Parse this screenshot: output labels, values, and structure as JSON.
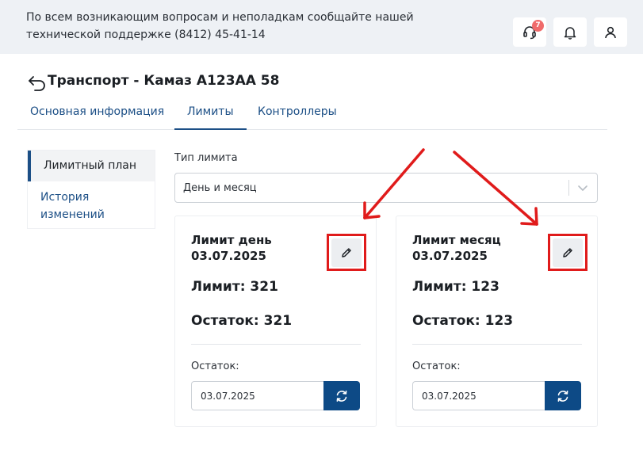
{
  "header": {
    "support_text": "По всем возникающим вопросам и неполадкам сообщайте нашей технической поддержке (8412) 45-41-14",
    "support_badge_count": "7",
    "icons": [
      "headset-icon",
      "bell-icon",
      "user-icon"
    ]
  },
  "page": {
    "title": "Транспорт - Камаз А123АА 58"
  },
  "tabs": [
    {
      "label": "Основная информация",
      "active": false
    },
    {
      "label": "Лимиты",
      "active": true
    },
    {
      "label": "Контроллеры",
      "active": false
    }
  ],
  "sidebar": {
    "items": [
      {
        "label": "Лимитный план",
        "active": true
      },
      {
        "label": "История изменений",
        "active": false
      }
    ]
  },
  "limit_type": {
    "label": "Тип лимита",
    "value": "День и месяц"
  },
  "cards": [
    {
      "title": "Лимит день 03.07.2025",
      "limit": "Лимит: 321",
      "rest": "Остаток: 321",
      "rest_label": "Остаток:",
      "date": "03.07.2025"
    },
    {
      "title": "Лимит месяц 03.07.2025",
      "limit": "Лимит: 123",
      "rest": "Остаток: 123",
      "rest_label": "Остаток:",
      "date": "03.07.2025"
    }
  ],
  "colors": {
    "accent": "#1c4f86",
    "button": "#0d4a86",
    "annotation": "#e01b1b",
    "badge": "#f06b6b",
    "topbar": "#eef1f5"
  }
}
